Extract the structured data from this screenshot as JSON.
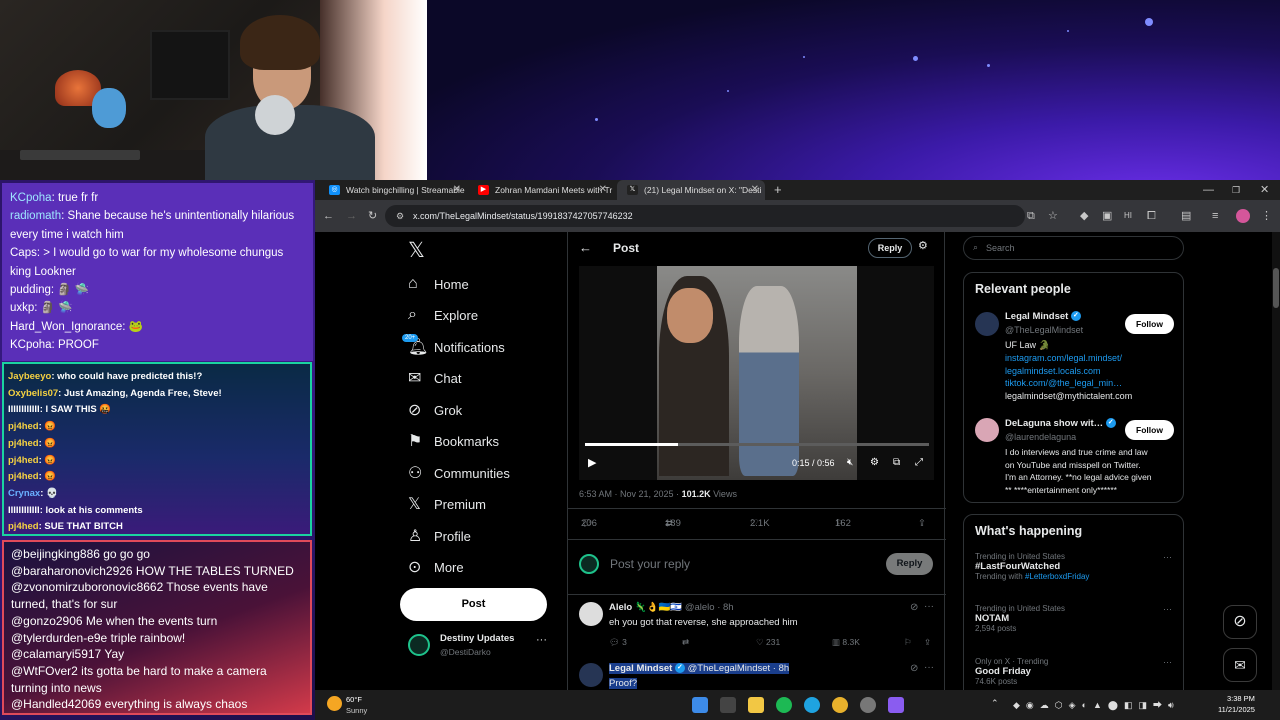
{
  "chat_top": [
    {
      "user": "KCpoha",
      "text": ": true fr fr"
    },
    {
      "user": "radiomath",
      "text": ": Shane because he's unintentionally hilarious"
    },
    {
      "user": "",
      "text": "every time i watch him"
    },
    {
      "user": "",
      "text": "Caps: > I would go to war for my wholesome chungus"
    },
    {
      "user": "",
      "text": "king Lookner"
    },
    {
      "user": "",
      "text": "pudding: 🗿 🛸"
    },
    {
      "user": "",
      "text": "uxkp: 🗿 🛸"
    },
    {
      "user": "",
      "text": "Hard_Won_Ignorance: 🐸"
    },
    {
      "user": "",
      "text": "KCpoha: PROOF"
    }
  ],
  "chat_mid": [
    {
      "user": "Jaybeeyo",
      "text": ": who could have predicted this!?"
    },
    {
      "user": "Oxybelis07",
      "text": ": Just Amazing, Agenda Free, Steve!"
    },
    {
      "user": "IIIIIIIIIIII",
      "text": ": I SAW THIS 🤬"
    },
    {
      "user": "pj4hed",
      "text": ": 😡"
    },
    {
      "user": "pj4hed",
      "text": ": 😡"
    },
    {
      "user": "pj4hed",
      "text": ": 😡"
    },
    {
      "user": "pj4hed",
      "text": ": 😡"
    },
    {
      "user": "Crynax",
      "text": ": 💀"
    },
    {
      "user": "IIIIIIIIIIII",
      "text": ": look at his comments"
    },
    {
      "user": "pj4hed",
      "text": ": SUE THAT BITCH"
    }
  ],
  "chat_bottom": [
    "@beijingking886 go go go",
    "@baraharonovich2926 HOW THE TABLES TURNED",
    "@zvonomirzuboronovic8662 Those events have",
    "turned, that's for sur",
    "@gonzo2906 Me when the events turn",
    "@tylerdurden-e9e triple rainbow!",
    "@calamaryi5917 Yay",
    "@WtFOver2 its gotta be hard to make a camera",
    "turning into news",
    "@Handled42069 everything is always chaos"
  ],
  "browser": {
    "tabs": [
      {
        "label": "Watch bingchilling | Streamable",
        "color": "#0f90fa"
      },
      {
        "label": "Zohran Mamdani Meets with Tr",
        "color": "#ff0000"
      },
      {
        "label": "(21) Legal Mindset on X: \"Desti",
        "color": "#222222"
      }
    ],
    "url": "x.com/TheLegalMindset/status/1991837427057746232"
  },
  "nav": {
    "items": [
      "Home",
      "Explore",
      "Notifications",
      "Chat",
      "Grok",
      "Bookmarks",
      "Communities",
      "Premium",
      "Profile",
      "More"
    ],
    "badge": "20+",
    "post_button": "Post",
    "account_name": "Destiny Updates",
    "account_handle": "@DestiDarko"
  },
  "post": {
    "header": "Post",
    "reply_button": "Reply",
    "video_time": "0:15 / 0:56",
    "video_progress": 0.27,
    "timestamp": "6:53 AM · Nov 21, 2025 · ",
    "views_count": "101.2K",
    "views_label": " Views",
    "replies": "206",
    "reposts": "189",
    "likes": "2.1K",
    "bookmarks": "162",
    "reply_placeholder": "Post your reply",
    "reply_submit": "Reply"
  },
  "replies": [
    {
      "name": "Alelo",
      "flags": "🦎👌🇺🇦🇮🇱",
      "handle": "@alelo · 8h",
      "text": "eh you got that reverse, she approached him",
      "replies": "3",
      "likes": "231",
      "views": "8.3K"
    },
    {
      "name": "Legal Mindset",
      "handle": "@TheLegalMindset · 8h",
      "text": "Proof?"
    }
  ],
  "search": {
    "placeholder": "Search"
  },
  "relevant": {
    "title": "Relevant people",
    "people": [
      {
        "name": "Legal Mindset",
        "handle": "@TheLegalMindset",
        "bio": [
          "UF Law 🐊",
          "instagram.com/legal.mindset/",
          "legalmindset.locals.com",
          "tiktok.com/@the_legal_min…",
          "legalmindset@mythictalent.com"
        ],
        "follow": "Follow"
      },
      {
        "name": "DeLaguna show wit…",
        "handle": "@laurendelaguna",
        "bio": [
          "I do interviews and true crime and law",
          "on YouTube and misspell on Twitter.",
          "I'm an Attorney. **no legal advice given",
          "** ****entertainment only******"
        ],
        "follow": "Follow"
      }
    ]
  },
  "happening": {
    "title": "What's happening",
    "trends": [
      {
        "context": "Trending in United States",
        "title": "#LastFourWatched",
        "sub_prefix": "Trending with ",
        "sub_link": "#LetterboxdFriday"
      },
      {
        "context": "Trending in United States",
        "title": "NOTAM",
        "sub_prefix": "2,594 posts",
        "sub_link": ""
      },
      {
        "context": "Only on X · Trending",
        "title": "Good Friday",
        "sub_prefix": "74.6K posts",
        "sub_link": ""
      }
    ]
  },
  "taskbar": {
    "weather_temp": "60°F",
    "weather_desc": "Sunny",
    "time": "3:38 PM",
    "date": "11/21/2025"
  }
}
